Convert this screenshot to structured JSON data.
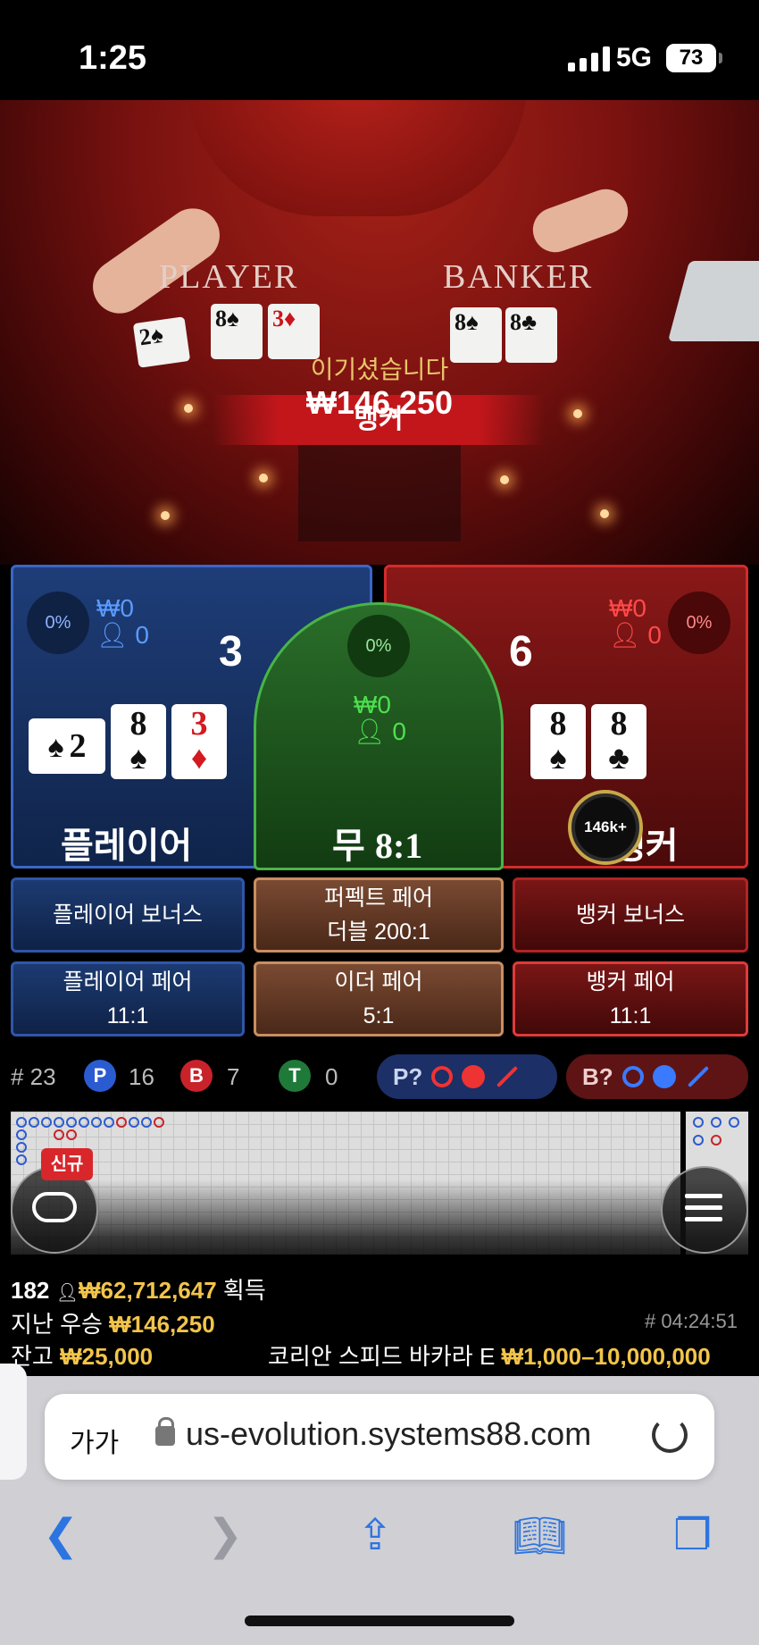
{
  "status_bar": {
    "time": "1:25",
    "network": "5G",
    "battery": "73"
  },
  "video": {
    "table_player_label": "PLAYER",
    "table_banker_label": "BANKER",
    "table_cards_player": [
      {
        "rank": "2",
        "suit": "♠",
        "red": false
      },
      {
        "rank": "8",
        "suit": "♠",
        "red": false
      },
      {
        "rank": "3",
        "suit": "♦",
        "red": true
      }
    ],
    "table_cards_banker": [
      {
        "rank": "8",
        "suit": "♠",
        "red": false
      },
      {
        "rank": "8",
        "suit": "♣",
        "red": false
      }
    ],
    "winner_banner": "뱅커",
    "win_message": "이기셨습니다",
    "win_amount": "₩146,250"
  },
  "bet_area": {
    "player": {
      "percent": "0%",
      "stake": "₩0",
      "bettors": "0",
      "score": "3",
      "label": "플레이어",
      "cards": [
        {
          "rank": "2",
          "suit": "♠",
          "red": false,
          "sideways": true
        },
        {
          "rank": "8",
          "suit": "♠",
          "red": false,
          "sideways": false
        },
        {
          "rank": "3",
          "suit": "♦",
          "red": true,
          "sideways": false
        }
      ]
    },
    "tie": {
      "percent": "0%",
      "stake": "₩0",
      "bettors": "0",
      "label": "무",
      "payout": "8:1"
    },
    "banker": {
      "percent": "0%",
      "stake": "₩0",
      "bettors": "0",
      "score": "6",
      "label": "뱅커",
      "cards": [
        {
          "rank": "8",
          "suit": "♠",
          "red": false
        },
        {
          "rank": "8",
          "suit": "♣",
          "red": false
        }
      ],
      "chip_label": "146k+"
    },
    "side_bets": {
      "player_bonus": "플레이어 보너스",
      "perfect_pair": "퍼펙트 페어",
      "perfect_pair_payout": "더블 200:1",
      "banker_bonus": "뱅커 보너스",
      "player_pair": "플레이어 페어",
      "player_pair_payout": "11:1",
      "either_pair": "이더 페어",
      "either_pair_payout": "5:1",
      "banker_pair": "뱅커 페어",
      "banker_pair_payout": "11:1"
    }
  },
  "stats": {
    "hand_number": "# 23",
    "player_letter": "P",
    "player_wins": "16",
    "banker_letter": "B",
    "banker_wins": "7",
    "tie_letter": "T",
    "ties": "0",
    "player_predict": "P?",
    "banker_predict": "B?"
  },
  "roadmap": {
    "new_badge": "신규"
  },
  "footer": {
    "players_count": "182",
    "total_won": "₩62,712,647",
    "won_label": "획득",
    "last_win_label": "지난 우승",
    "last_win_amount": "₩146,250",
    "round_id": "# 04:24:51",
    "balance_label": "잔고",
    "balance": "₩25,000",
    "table_name": "코리안 스피드 바카라 E",
    "limits": "₩1,000–10,000,000"
  },
  "browser": {
    "text_size_button": "가가",
    "url": "us-evolution.systems88.com"
  },
  "colors": {
    "player": "#1e3d78",
    "banker": "#8a1818",
    "tie": "#2a6e2a",
    "gold": "#f2c44a",
    "link_blue": "#2c74e0"
  }
}
